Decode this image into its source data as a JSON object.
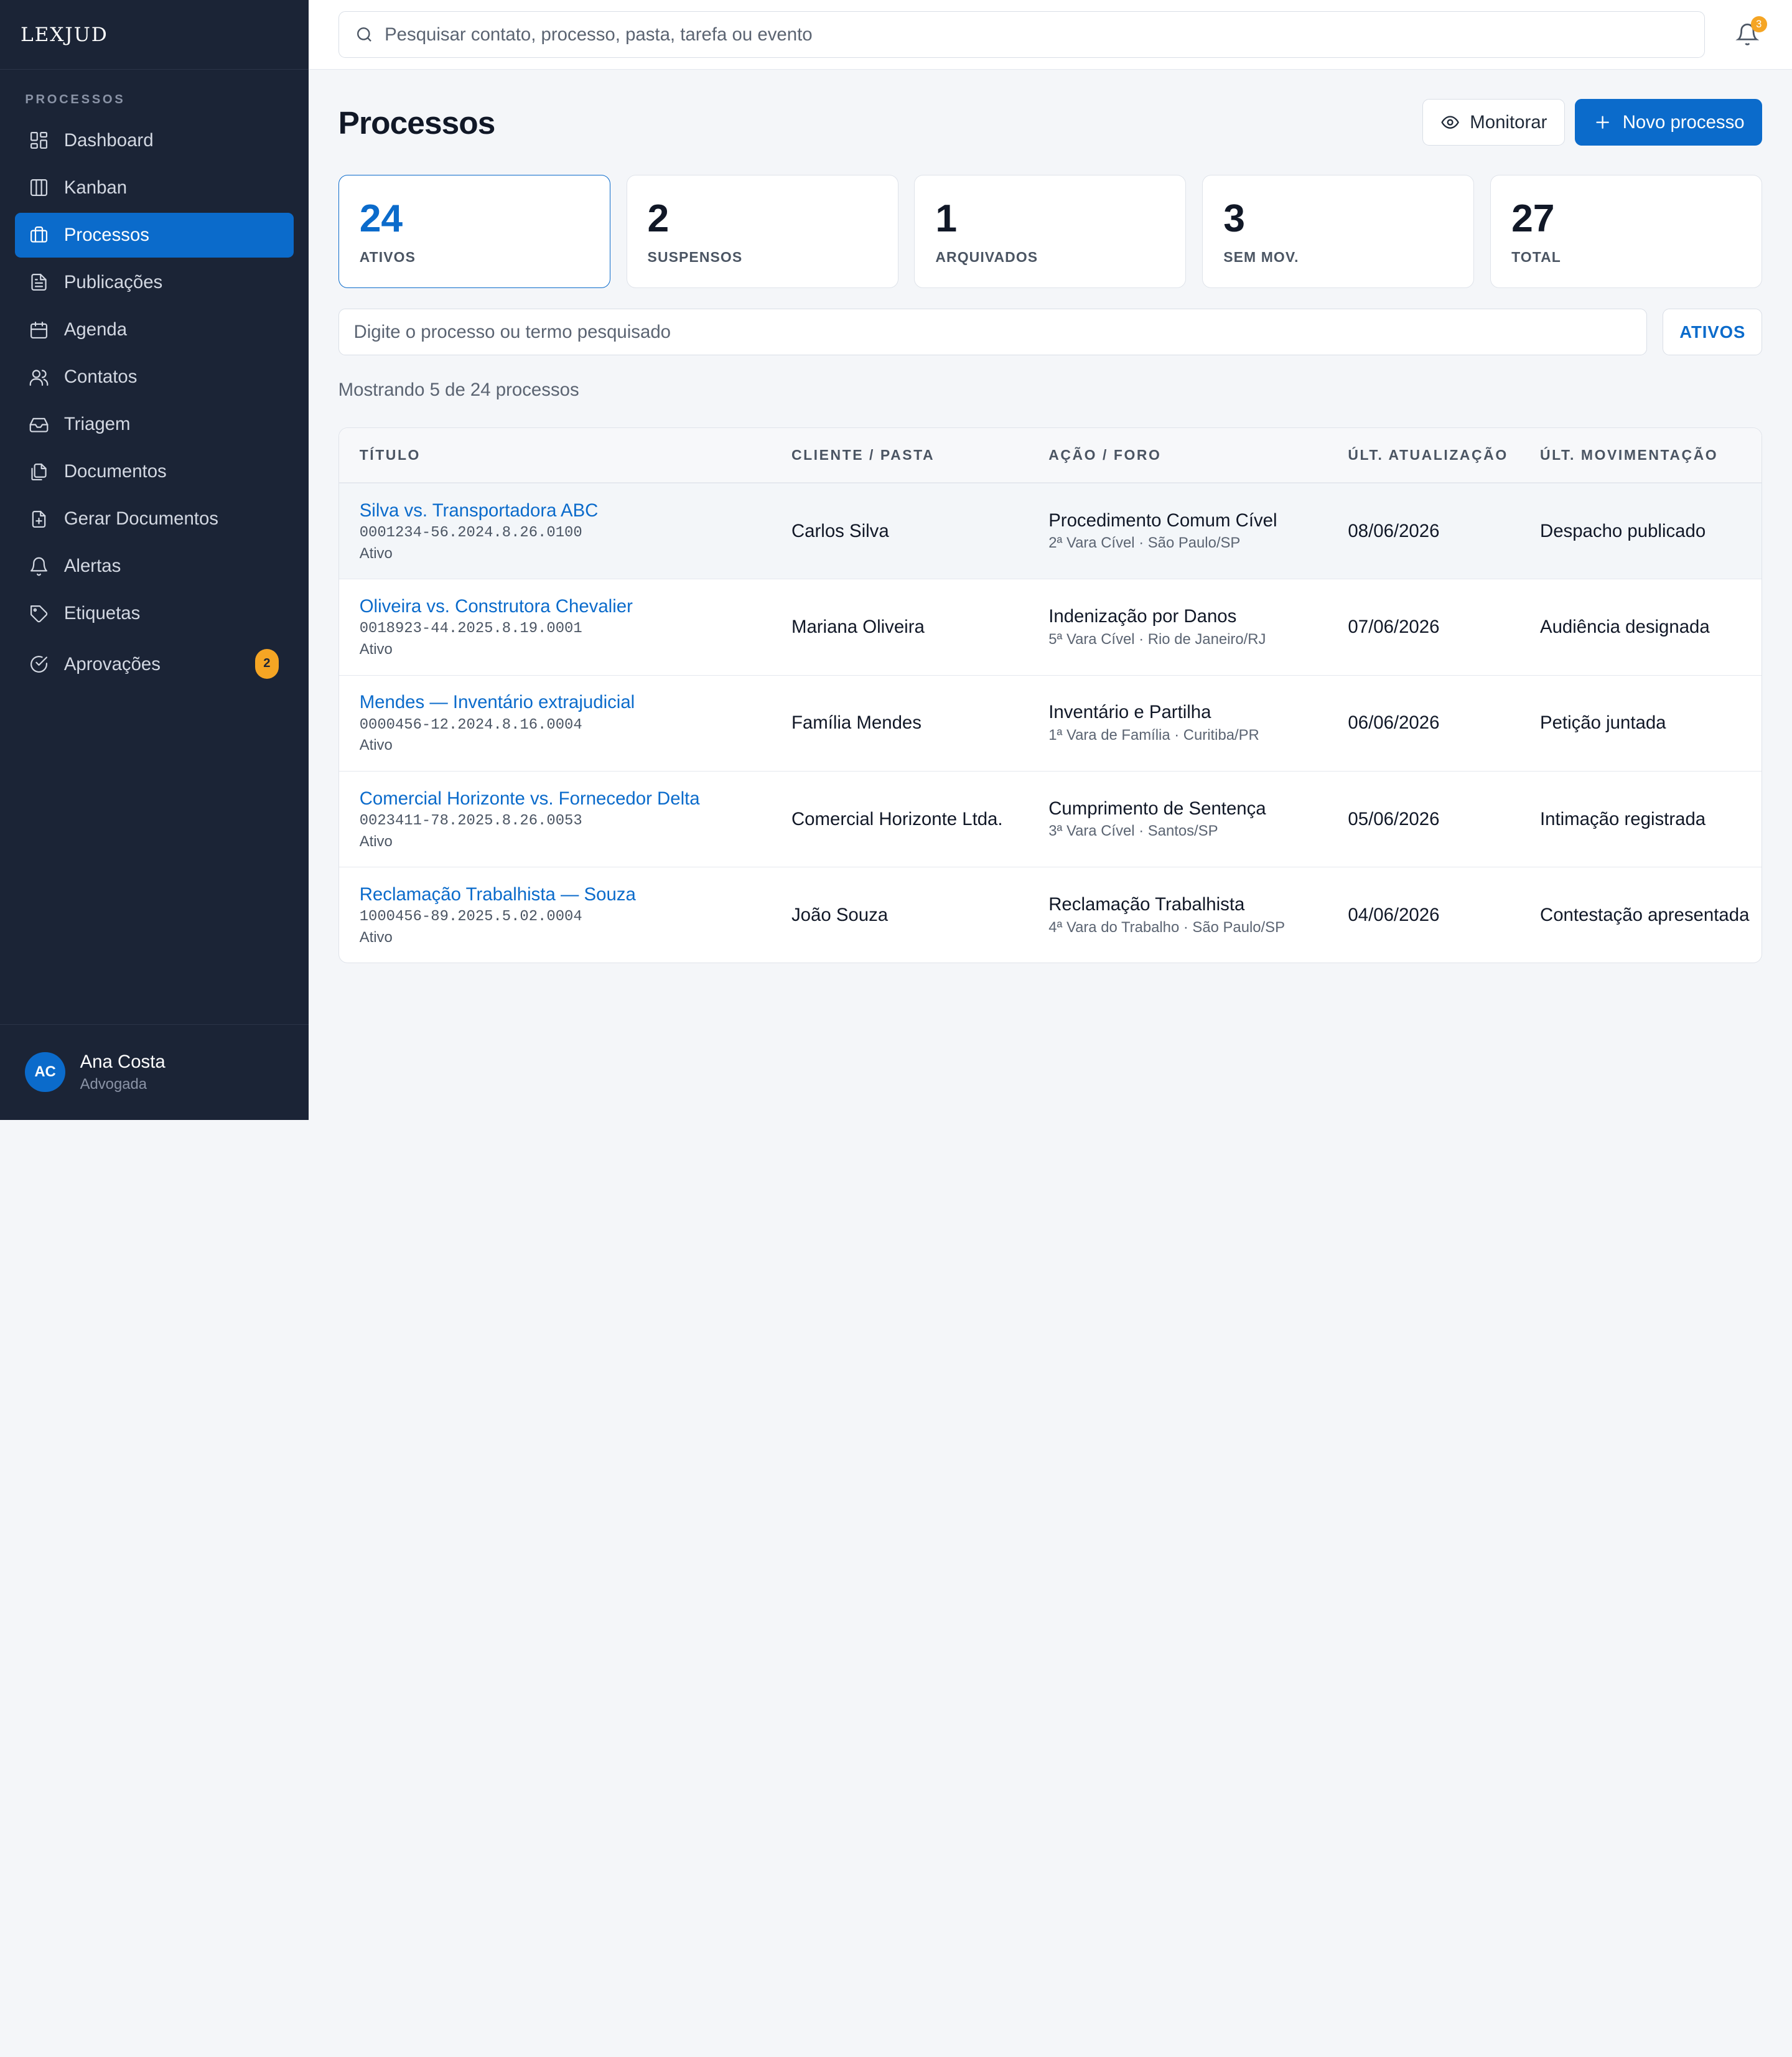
{
  "brand": "LEXJUD",
  "sidebar": {
    "section": "PROCESSOS",
    "items": [
      {
        "label": "Dashboard"
      },
      {
        "label": "Kanban"
      },
      {
        "label": "Processos"
      },
      {
        "label": "Publicações"
      },
      {
        "label": "Agenda"
      },
      {
        "label": "Contatos"
      },
      {
        "label": "Triagem"
      },
      {
        "label": "Documentos"
      },
      {
        "label": "Gerar Documentos"
      },
      {
        "label": "Alertas"
      },
      {
        "label": "Etiquetas"
      },
      {
        "label": "Aprovações",
        "badge": "2"
      }
    ],
    "active_index": 2,
    "user": {
      "initials": "AC",
      "name": "Ana Costa",
      "role": "Advogada"
    }
  },
  "topbar": {
    "search_placeholder": "Pesquisar contato, processo, pasta, tarefa ou evento",
    "notifications": "3"
  },
  "page": {
    "title": "Processos",
    "monitor_label": "Monitorar",
    "new_label": "Novo processo"
  },
  "stats": [
    {
      "value": "24",
      "label": "ATIVOS"
    },
    {
      "value": "2",
      "label": "SUSPENSOS"
    },
    {
      "value": "1",
      "label": "ARQUIVADOS"
    },
    {
      "value": "3",
      "label": "SEM MOV."
    },
    {
      "value": "27",
      "label": "TOTAL"
    }
  ],
  "filter": {
    "placeholder": "Digite o processo ou termo pesquisado",
    "status_button": "ATIVOS"
  },
  "showing": "Mostrando 5 de 24 processos",
  "table": {
    "headers": [
      "TÍTULO",
      "CLIENTE / PASTA",
      "AÇÃO / FORO",
      "ÚLT. ATUALIZAÇÃO",
      "ÚLT. MOVIMENTAÇÃO"
    ],
    "rows": [
      {
        "title": "Silva vs. Transportadora ABC",
        "number": "0001234-56.2024.8.26.0100",
        "status": "Ativo",
        "client": "Carlos Silva",
        "acao": "Procedimento Comum Cível",
        "foro": "2ª Vara Cível · São Paulo/SP",
        "updated": "08/06/2026",
        "movement": "Despacho publicado"
      },
      {
        "title": "Oliveira vs. Construtora Chevalier",
        "number": "0018923-44.2025.8.19.0001",
        "status": "Ativo",
        "client": "Mariana Oliveira",
        "acao": "Indenização por Danos",
        "foro": "5ª Vara Cível · Rio de Janeiro/RJ",
        "updated": "07/06/2026",
        "movement": "Audiência designada"
      },
      {
        "title": "Mendes — Inventário extrajudicial",
        "number": "0000456-12.2024.8.16.0004",
        "status": "Ativo",
        "client": "Família Mendes",
        "acao": "Inventário e Partilha",
        "foro": "1ª Vara de Família · Curitiba/PR",
        "updated": "06/06/2026",
        "movement": "Petição juntada"
      },
      {
        "title": "Comercial Horizonte vs. Fornecedor Delta",
        "number": "0023411-78.2025.8.26.0053",
        "status": "Ativo",
        "client": "Comercial Horizonte Ltda.",
        "acao": "Cumprimento de Sentença",
        "foro": "3ª Vara Cível · Santos/SP",
        "updated": "05/06/2026",
        "movement": "Intimação registrada"
      },
      {
        "title": "Reclamação Trabalhista — Souza",
        "number": "1000456-89.2025.5.02.0004",
        "status": "Ativo",
        "client": "João Souza",
        "acao": "Reclamação Trabalhista",
        "foro": "4ª Vara do Trabalho · São Paulo/SP",
        "updated": "04/06/2026",
        "movement": "Contestação apresentada"
      }
    ]
  },
  "colors": {
    "accent": "#0b6bcb",
    "sidebar_bg": "#1b2436",
    "badge": "#f5a524"
  }
}
